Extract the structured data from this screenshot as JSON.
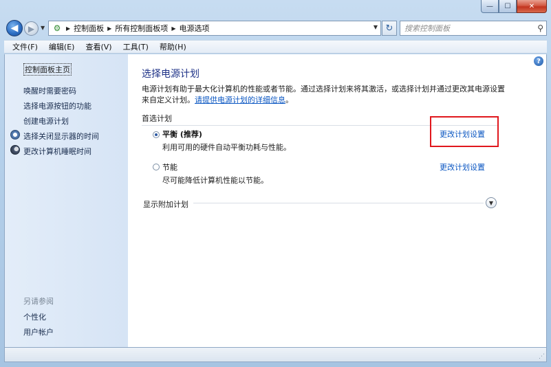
{
  "window": {
    "caption_buttons": {
      "minimize": "—",
      "maximize": "☐",
      "close": "✕"
    }
  },
  "nav": {
    "breadcrumbs": [
      "控制面板",
      "所有控制面板项",
      "电源选项"
    ],
    "search_placeholder": "搜索控制面板",
    "icons": {
      "back": "back-arrow-icon",
      "forward": "forward-arrow-icon",
      "refresh": "refresh-icon",
      "search": "search-icon"
    }
  },
  "menu": {
    "items": [
      "文件(F)",
      "编辑(E)",
      "查看(V)",
      "工具(T)",
      "帮助(H)"
    ]
  },
  "sidebar": {
    "home": "控制面板主页",
    "links": [
      "唤醒时需要密码",
      "选择电源按钮的功能",
      "创建电源计划",
      "选择关闭显示器的时间",
      "更改计算机睡眠时间"
    ],
    "see_also": "另请参阅",
    "see_also_links": [
      "个性化",
      "用户帐户"
    ]
  },
  "main": {
    "title": "选择电源计划",
    "desc_line1": "电源计划有助于最大化计算机的性能或者节能。通过选择计划来将其激活，或选择计划并通过更改其电源设置",
    "desc_line2_prefix": "来自定义计划。",
    "desc_link": "请提供电源计划的详细信息",
    "desc_suffix": "。",
    "group_heading": "首选计划",
    "plans": [
      {
        "name": "平衡 (推荐)",
        "description": "利用可用的硬件自动平衡功耗与性能。",
        "link": "更改计划设置",
        "selected": true
      },
      {
        "name": "节能",
        "description": "尽可能降低计算机性能以节能。",
        "link": "更改计划设置",
        "selected": false
      }
    ],
    "show_more": "显示附加计划"
  },
  "colors": {
    "title_blue": "#1e3287",
    "link_blue": "#0a56c2",
    "highlight_red": "#e0161c"
  }
}
